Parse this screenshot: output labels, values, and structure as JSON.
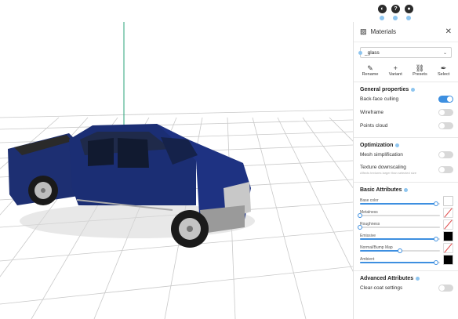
{
  "panel": {
    "title": "Materials",
    "material_value": "_glass",
    "actions": [
      {
        "label": "Rename",
        "icon": "pencil-icon"
      },
      {
        "label": "Variant",
        "icon": "plus-icon"
      },
      {
        "label": "Presets",
        "icon": "link-icon"
      },
      {
        "label": "Select",
        "icon": "eyedropper-icon"
      }
    ],
    "general": {
      "title": "General properties",
      "backface_label": "Back-face culling",
      "backface_on": true,
      "wireframe_label": "Wireframe",
      "wireframe_on": false,
      "points_label": "Points cloud",
      "points_on": false
    },
    "optimization": {
      "title": "Optimization",
      "mesh_label": "Mesh simplification",
      "texture_label": "Texture downscaling",
      "texture_note": "Affects textures larger than selected size"
    },
    "basic": {
      "title": "Basic Attributes",
      "sliders": [
        {
          "label": "Base color",
          "value": 0.95,
          "swatch": "white"
        },
        {
          "label": "Metalness",
          "value": 0.0,
          "swatch": "none"
        },
        {
          "label": "Roughness",
          "value": 0.0,
          "swatch": "none"
        },
        {
          "label": "Emissive",
          "value": 0.95,
          "swatch": "black"
        },
        {
          "label": "Normal/Bump Map",
          "value": 0.5,
          "swatch": "none"
        },
        {
          "label": "Ambient",
          "value": 0.95,
          "swatch": "black"
        }
      ]
    },
    "advanced": {
      "title": "Advanced Attributes",
      "clearcoat_label": "Clear-coat settings"
    }
  },
  "colors": {
    "accent": "#3d8fe0",
    "truck_body": "#1c2f78",
    "grid": "#cfcfcf"
  }
}
